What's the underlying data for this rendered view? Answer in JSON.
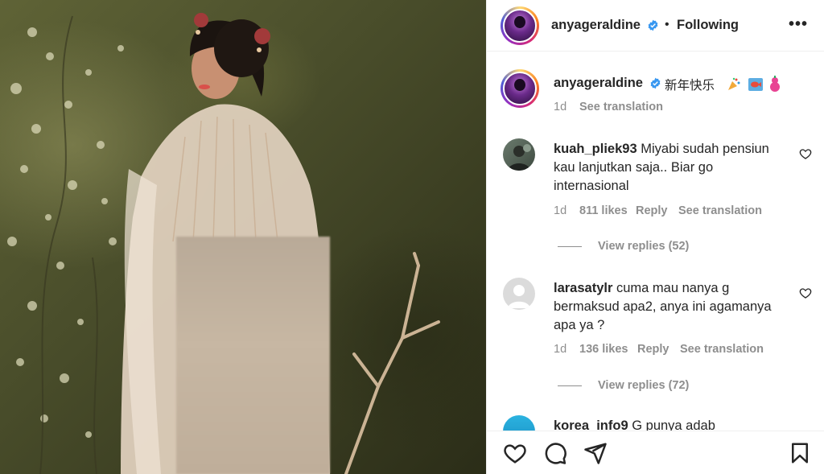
{
  "post": {
    "username": "anyageraldine",
    "follow_status": "Following",
    "more_label": "•••",
    "separator": "•"
  },
  "caption": {
    "username": "anyageraldine",
    "text": "新年快乐",
    "emojis": [
      "party-popper",
      "fish",
      "gourd"
    ],
    "time": "1d",
    "see_translation": "See translation"
  },
  "comments": [
    {
      "username": "kuah_pliek93",
      "text": "Miyabi sudah pensiun kau lanjutkan saja.. Biar go internasional",
      "time": "1d",
      "likes": "811 likes",
      "reply": "Reply",
      "see_translation": "See translation",
      "view_replies": "View replies (52)"
    },
    {
      "username": "larasatylr",
      "text": "cuma mau nanya g bermaksud apa2, anya ini agamanya apa ya ?",
      "time": "1d",
      "likes": "136 likes",
      "reply": "Reply",
      "see_translation": "See translation",
      "view_replies": "View replies (72)"
    },
    {
      "username": "korea_info9",
      "text": "G punya adab"
    }
  ],
  "actions": {
    "icons": [
      "heart-icon",
      "comment-icon",
      "share-icon",
      "bookmark-icon"
    ]
  },
  "colors": {
    "text": "#262626",
    "secondary": "#8e8e8e",
    "verified": "#3897f0",
    "border": "#efefef"
  }
}
